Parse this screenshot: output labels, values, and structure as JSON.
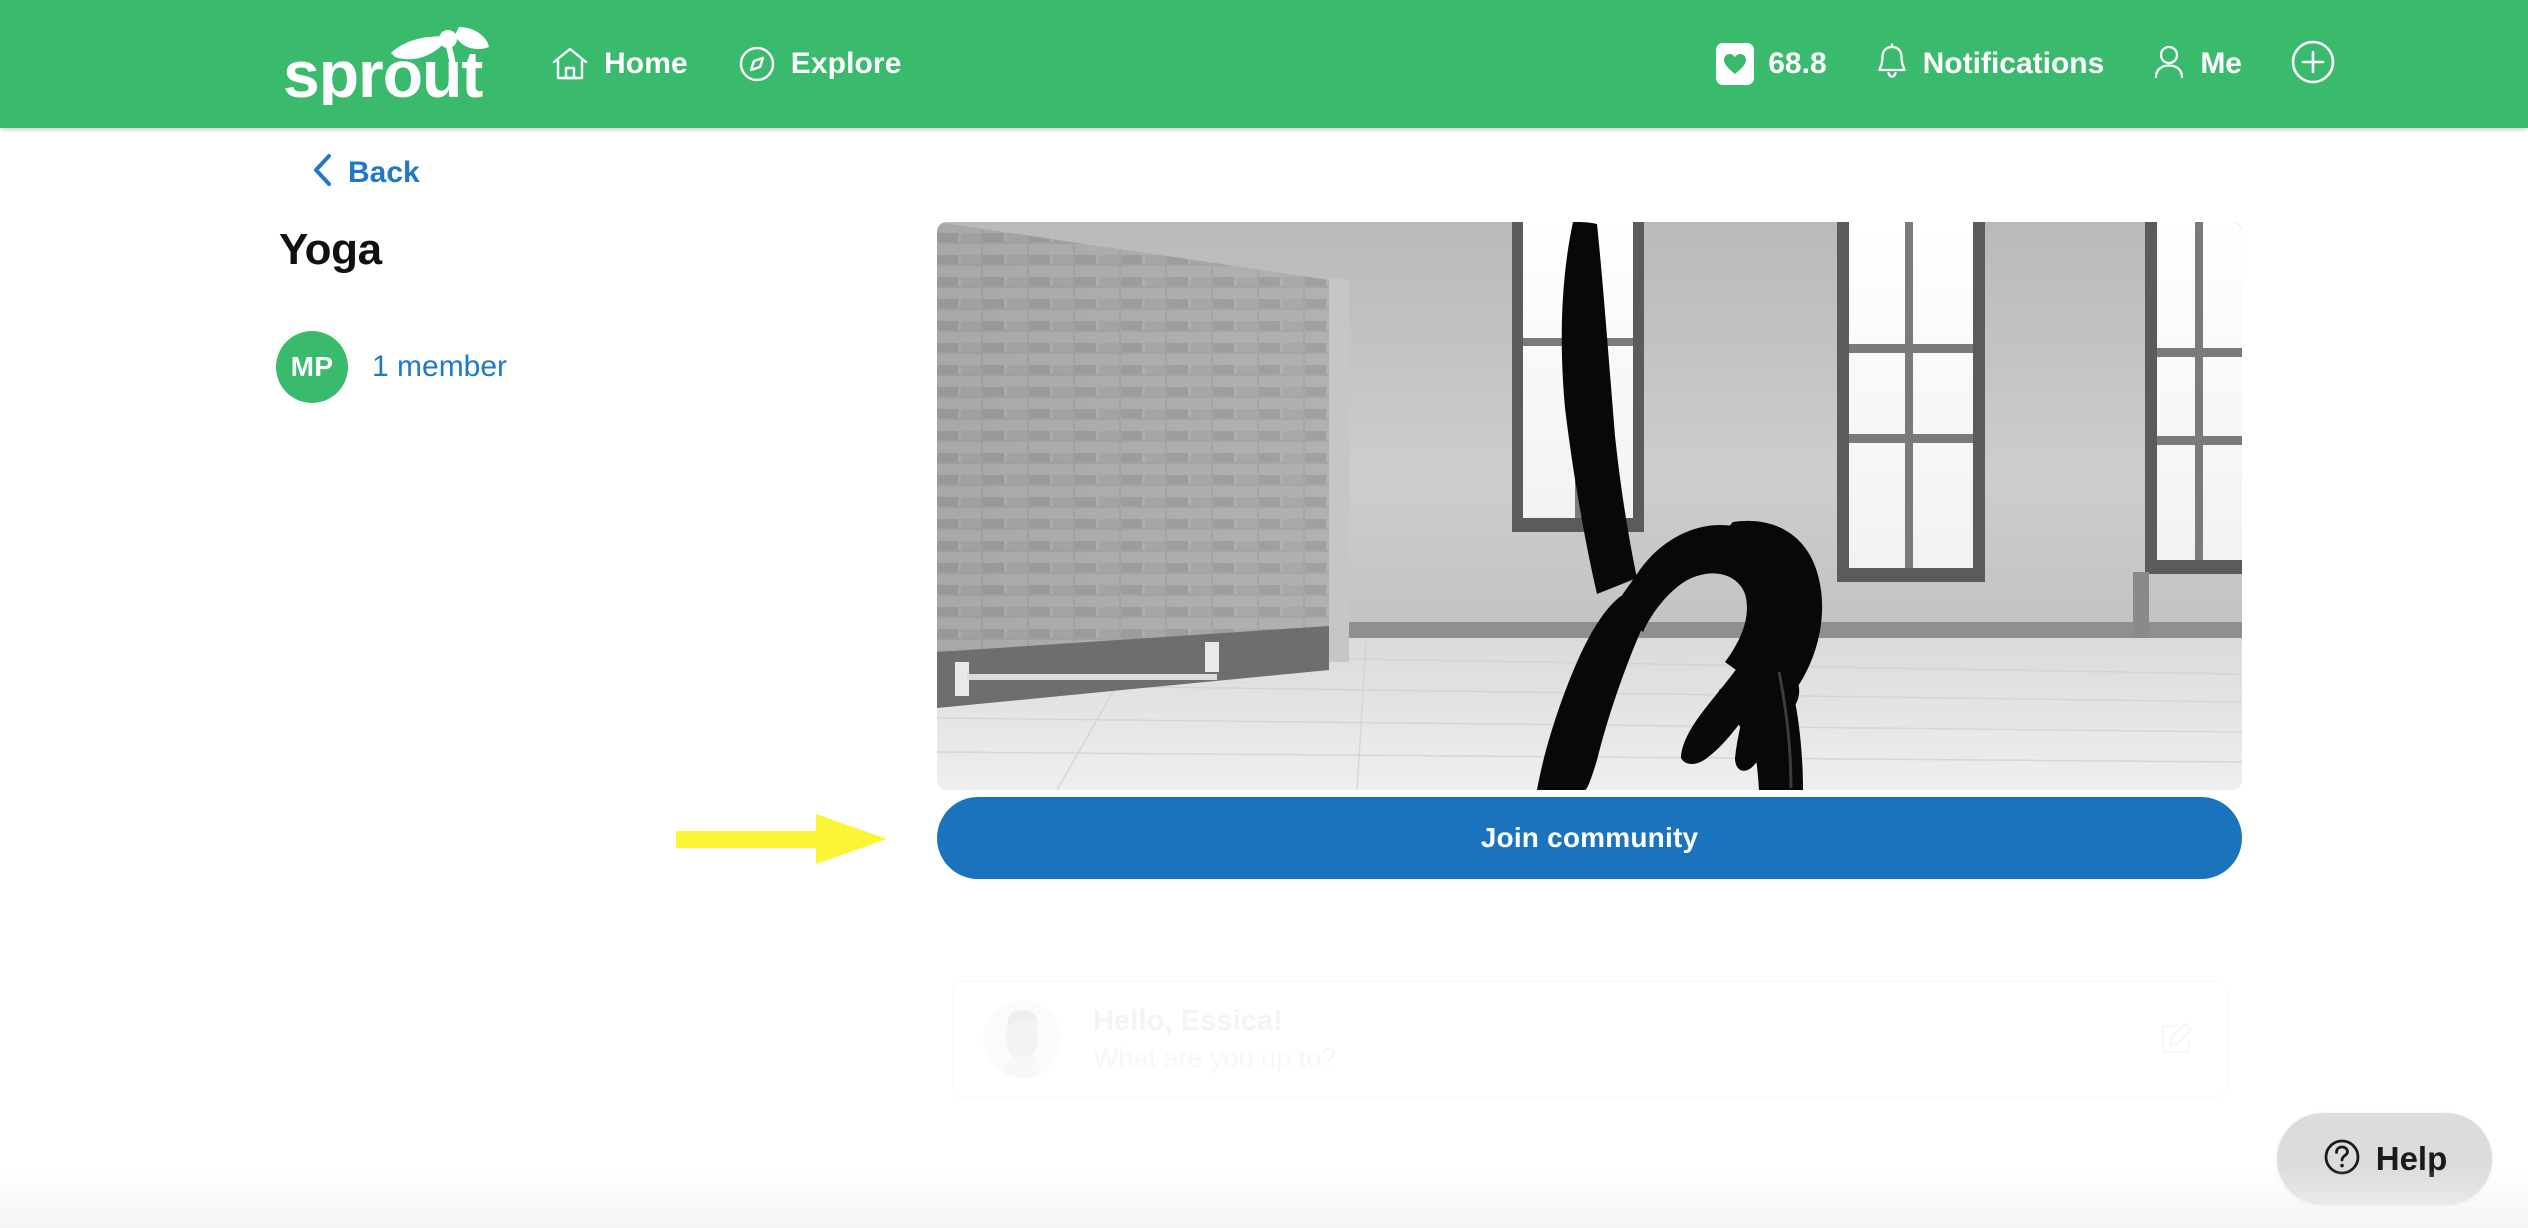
{
  "header": {
    "brand": "sprout",
    "nav": [
      {
        "label": "Home",
        "icon": "home-icon"
      },
      {
        "label": "Explore",
        "icon": "compass-icon"
      }
    ],
    "right": [
      {
        "label": "68.8",
        "icon": "heart-card-icon",
        "name": "points-balance"
      },
      {
        "label": "Notifications",
        "icon": "bell-icon",
        "name": "notifications"
      },
      {
        "label": "Me",
        "icon": "person-icon",
        "name": "me"
      },
      {
        "label": "",
        "icon": "plus-circle-icon",
        "name": "create"
      }
    ],
    "bg_color": "#3ABA6C"
  },
  "back": {
    "label": "Back",
    "icon": "chevron-left-icon",
    "color": "#2079C8"
  },
  "community": {
    "title": "Yoga",
    "avatar_initials": "MP",
    "avatar_color": "#3ABA6C",
    "member_count_label": "1 member",
    "member_count_color": "#2079C8",
    "hero_image_alt": "black and white photo of a person in a yoga backbend pose in a brick-walled studio",
    "join_button_label": "Join community",
    "join_button_color": "#1C73BD"
  },
  "annotation": {
    "type": "arrow-right",
    "color": "#FAF535",
    "points_to": "Join community"
  },
  "composer": {
    "greeting": "Hello, Essica!",
    "prompt": "What are you up to?",
    "edit_icon": "pencil-square-icon"
  },
  "help": {
    "label": "Help",
    "icon": "question-circle-icon",
    "bg_color": "#DCDCDC"
  }
}
